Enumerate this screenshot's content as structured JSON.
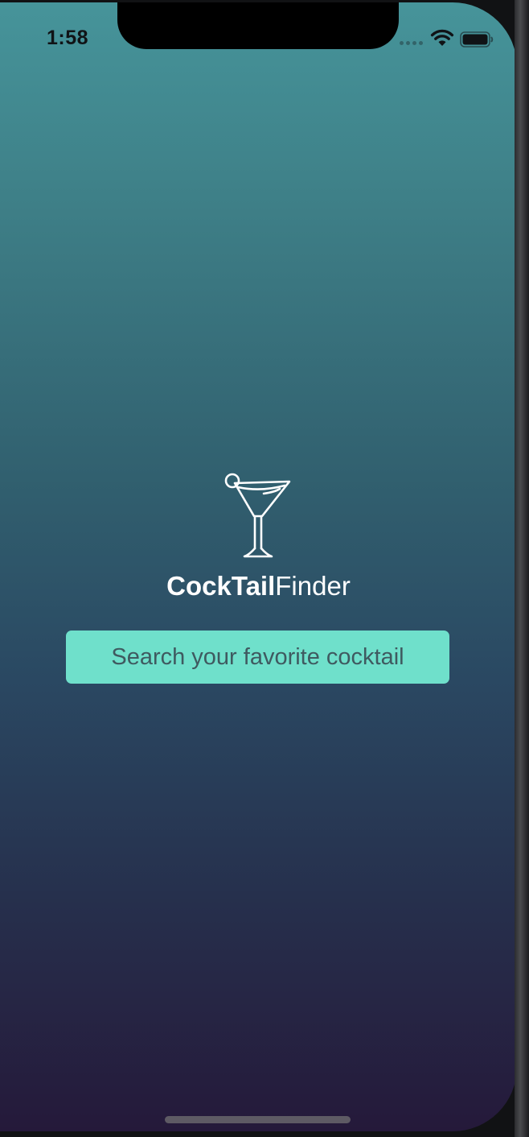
{
  "status_bar": {
    "time": "1:58",
    "icons": [
      "signal-dots-icon",
      "wifi-icon",
      "battery-icon"
    ]
  },
  "app": {
    "logo_icon": "martini-glass-icon",
    "brand_bold": "CockTail",
    "brand_light": "Finder",
    "search_label": "Search your favorite cocktail"
  },
  "colors": {
    "gradient_top": "#46949a",
    "gradient_bottom": "#25193a",
    "search_button_bg": "#6fe0cb",
    "search_button_text": "#3f5a60",
    "brand_text": "#ffffff"
  }
}
